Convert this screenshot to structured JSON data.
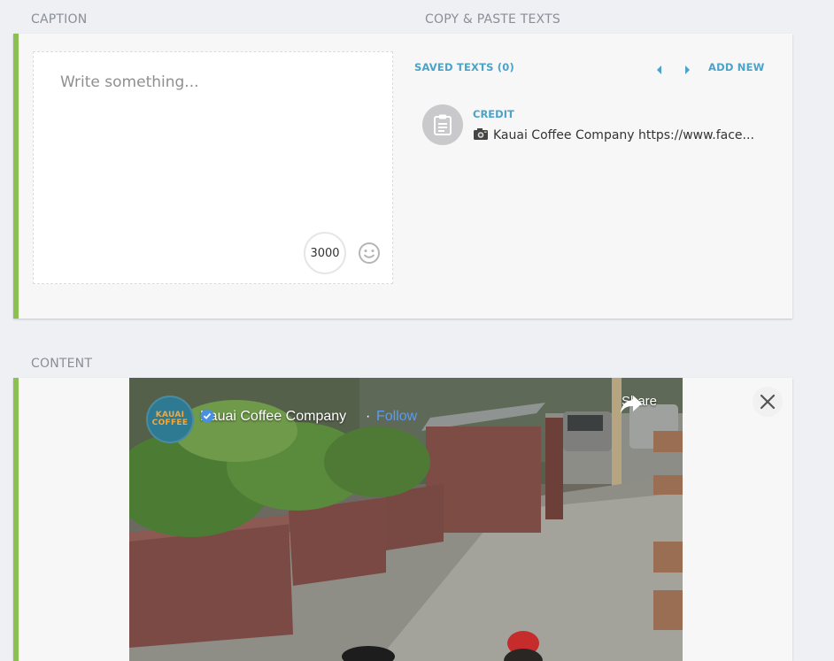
{
  "caption": {
    "section_label": "CAPTION",
    "placeholder": "Write something...",
    "char_remaining": "3000"
  },
  "copy_paste": {
    "section_label": "COPY & PASTE TEXTS",
    "saved_texts_label": "SAVED TEXTS (0)",
    "add_new_label": "ADD NEW",
    "items": [
      {
        "title": "CREDIT",
        "text": "Kauai Coffee Company https://www.face..."
      }
    ]
  },
  "content": {
    "section_label": "CONTENT",
    "video": {
      "page_name": "Kauai Coffee Company",
      "follow_label": "Follow",
      "share_label": "Share",
      "avatar_text": "KAUAI COFFEE"
    }
  },
  "colors": {
    "accent_green": "#8cc152",
    "link_blue": "#4aa3c8",
    "fb_blue": "#5b9bf0"
  },
  "icons": [
    "emoji-icon",
    "chevron-left-icon",
    "chevron-right-icon",
    "clipboard-icon",
    "camera-icon",
    "close-icon",
    "verified-icon",
    "share-icon"
  ]
}
